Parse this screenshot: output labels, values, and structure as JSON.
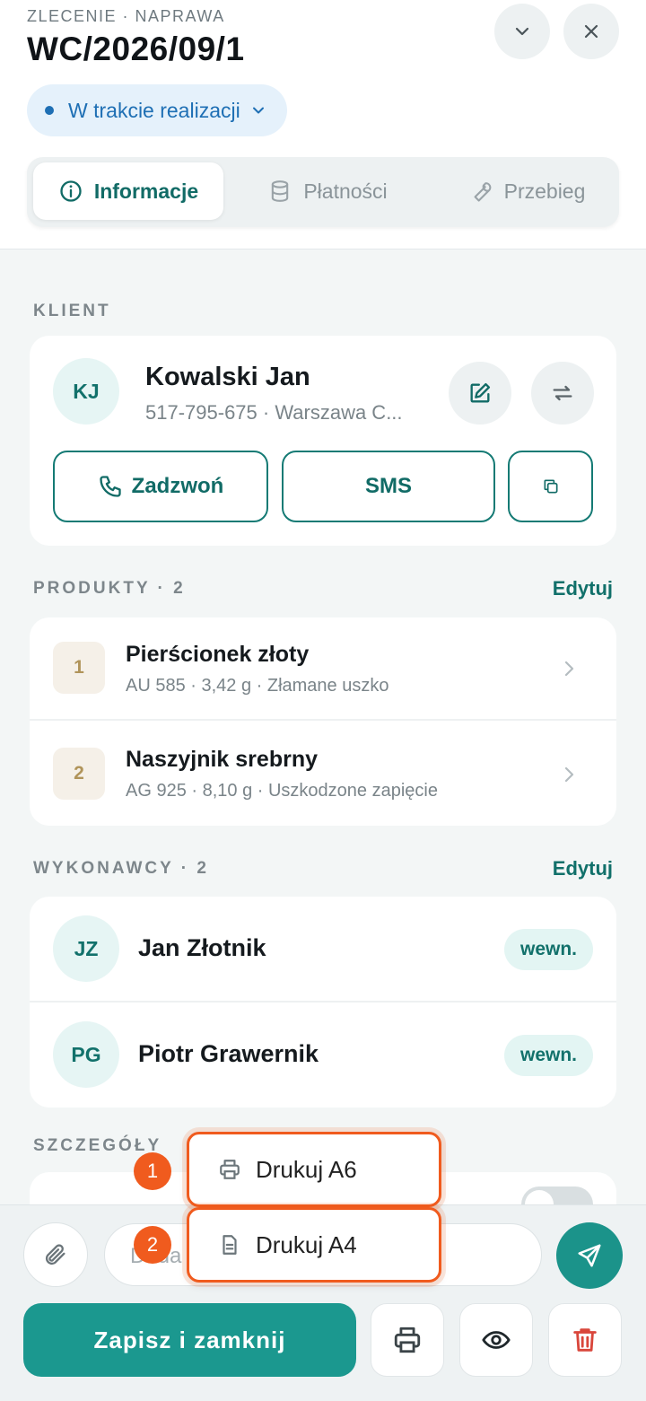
{
  "header": {
    "order_label": "ZLECENIE · NAPRAWA",
    "order_number": "WC/2026/09/1",
    "status": "W trakcie realizacji"
  },
  "tabs": [
    {
      "label": "Informacje",
      "icon": "info-icon",
      "active": true
    },
    {
      "label": "Płatności",
      "icon": "database-icon",
      "active": false
    },
    {
      "label": "Przebieg",
      "icon": "wrench-icon",
      "active": false
    }
  ],
  "client": {
    "section_label": "KLIENT",
    "initials": "KJ",
    "name": "Kowalski Jan",
    "subtitle": "517-795-675 · Warszawa C...",
    "call_label": "Zadzwoń",
    "sms_label": "SMS"
  },
  "products": {
    "section_label": "PRODUKTY · 2",
    "edit_label": "Edytuj",
    "items": [
      {
        "num": "1",
        "name": "Pierścionek złoty",
        "detail": "AU 585 · 3,42 g · Złamane uszko"
      },
      {
        "num": "2",
        "name": "Naszyjnik srebrny",
        "detail": "AG 925 · 8,10 g · Uszkodzone zapięcie"
      }
    ]
  },
  "workers": {
    "section_label": "WYKONAWCY · 2",
    "edit_label": "Edytuj",
    "items": [
      {
        "initials": "JZ",
        "name": "Jan Złotnik",
        "tag": "wewn."
      },
      {
        "initials": "PG",
        "name": "Piotr Grawernik",
        "tag": "wewn."
      }
    ]
  },
  "details": {
    "section_label": "SZCZEGÓŁY"
  },
  "composer": {
    "placeholder": "Doda"
  },
  "print_menu": {
    "items": [
      {
        "marker": "1",
        "label": "Drukuj A6",
        "icon": "printer-icon"
      },
      {
        "marker": "2",
        "label": "Drukuj A4",
        "icon": "document-icon"
      }
    ]
  },
  "footer": {
    "save_label": "Zapisz i zamknij"
  },
  "colors": {
    "accent": "#1b988f",
    "accent_dark": "#116b66",
    "status_blue": "#1e6fb4",
    "highlight_orange": "#f05b1e",
    "delete_red": "#d9463b"
  }
}
